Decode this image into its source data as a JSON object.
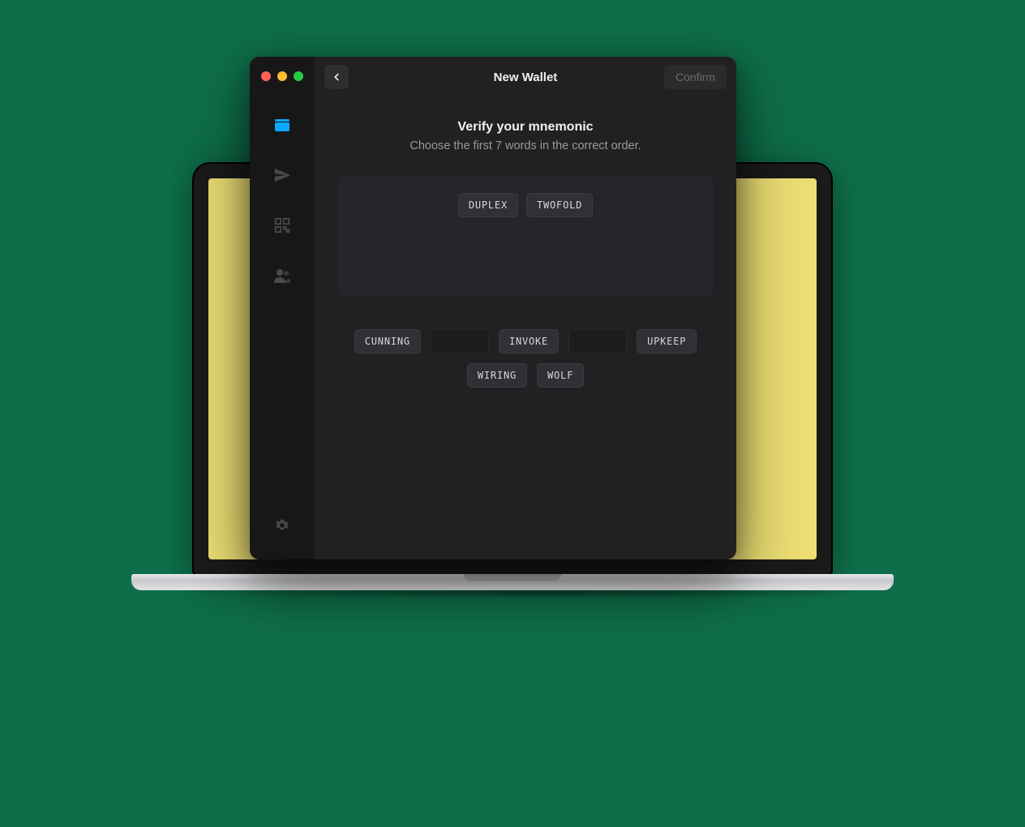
{
  "header": {
    "title": "New Wallet",
    "confirm_label": "Confirm"
  },
  "content": {
    "heading": "Verify your mnemonic",
    "subheading": "Choose the first 7 words in the correct order."
  },
  "sidebar": {
    "items": [
      {
        "name": "wallet",
        "active": true
      },
      {
        "name": "send",
        "active": false
      },
      {
        "name": "qr",
        "active": false
      },
      {
        "name": "contacts",
        "active": false
      }
    ],
    "settings_name": "settings"
  },
  "selected_words": [
    "DUPLEX",
    "TWOFOLD"
  ],
  "available_words": [
    {
      "label": "CUNNING",
      "used": false
    },
    {
      "label": "",
      "used": true
    },
    {
      "label": "INVOKE",
      "used": false
    },
    {
      "label": "",
      "used": true
    },
    {
      "label": "UPKEEP",
      "used": false
    },
    {
      "label": "WIRING",
      "used": false
    },
    {
      "label": "WOLF",
      "used": false
    }
  ],
  "colors": {
    "accent": "#0aa8ff",
    "background_green": "#0f6e4a",
    "screen_yellow": "#ecde73"
  }
}
